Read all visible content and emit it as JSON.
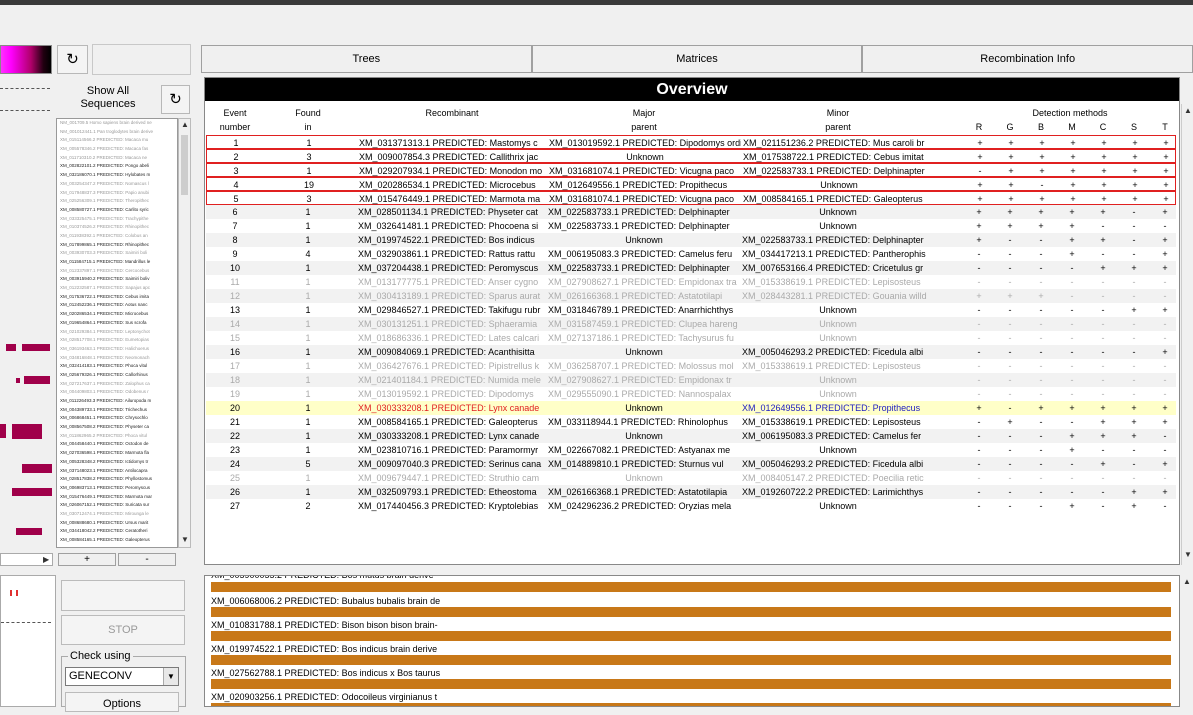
{
  "left": {
    "show_all_label": "Show All\nSequences",
    "plus_label": "+",
    "minus_label": "-",
    "sequences": [
      {
        "text": "NM_001709.5 Homo sapiens brain derived ne",
        "dim": true
      },
      {
        "text": "NM_001012441.1 Pan troglodytes brain derive",
        "dim": true
      },
      {
        "text": "XM_015114566.2 PREDICTED: Macaca mu",
        "dim": true
      },
      {
        "text": "XM_005578346.2 PREDICTED: Macaca fas",
        "dim": true
      },
      {
        "text": "XM_011710310.2 PREDICTED: Macaca ne",
        "dim": true
      },
      {
        "text": "XM_002822101.2 PREDICTED: Pongo abeli",
        "dim": false
      },
      {
        "text": "XM_032186070.1 PREDICTED: Hylobates m",
        "dim": false
      },
      {
        "text": "XM_003254347.2 PREDICTED: Nomascus l",
        "dim": true
      },
      {
        "text": "XM_017948837.3 PREDICTED: Papio anubi",
        "dim": true
      },
      {
        "text": "XM_025256309.1 PREDICTED: Theropithec",
        "dim": true
      },
      {
        "text": "XM_008580727.1 PREDICTED: Carlito syric",
        "dim": false
      },
      {
        "text": "XM_033325475.1 PREDICTED: Trachypithe",
        "dim": true
      },
      {
        "text": "XM_010374526.2 PREDICTED: Rhinopithec",
        "dim": true
      },
      {
        "text": "XM_011938392.1 PREDICTED: Colobus an",
        "dim": true
      },
      {
        "text": "XM_017899865.1 PREDICTED: Rhinopithec",
        "dim": false
      },
      {
        "text": "XM_003930703.3 PREDICTED: Saimiri boli",
        "dim": true
      },
      {
        "text": "XM_011584715.1 PREDICTED: Mandrillus le",
        "dim": false
      },
      {
        "text": "XM_012337897.1 PREDICTED: Cercocebus",
        "dim": true
      },
      {
        "text": "XM_003915940.2 PREDICTED: Saimiri boliv",
        "dim": false
      },
      {
        "text": "XM_012232587.1 PREDICTED: Sapajus apc",
        "dim": true
      },
      {
        "text": "XM_017536722.1 PREDICTED: Cebus imita",
        "dim": false
      },
      {
        "text": "XM_012452236.1 PREDICTED: Aotus nanc",
        "dim": false
      },
      {
        "text": "XM_020286534.1 PREDICTED: Microcebus",
        "dim": false
      },
      {
        "text": "XM_019654864.1 PREDICTED: Sus scrofa",
        "dim": false
      },
      {
        "text": "XM_021029384.1 PREDICTED: Leptonychot",
        "dim": true
      },
      {
        "text": "XM_028517708.1 PREDICTED: Eumetopias",
        "dim": true
      },
      {
        "text": "XM_036193463.1 PREDICTED: Halichoerus",
        "dim": true
      },
      {
        "text": "XM_034816848.1 PREDICTED: Neomonach",
        "dim": true
      },
      {
        "text": "XM_032414183.1 PREDICTED: Phoca vitul",
        "dim": false
      },
      {
        "text": "XM_025679326.1 PREDICTED: Callorhinus",
        "dim": false
      },
      {
        "text": "XM_027217637.1 PREDICTED: Zalophus ca",
        "dim": true
      },
      {
        "text": "XM_004409803.1 PREDICTED: Odobenus r",
        "dim": true
      },
      {
        "text": "XM_011226493.3 PREDICTED: Ailuropoda m",
        "dim": false
      },
      {
        "text": "XM_004389733.1 PREDICTED: Trichechus",
        "dim": false
      },
      {
        "text": "XM_006868451.1 PREDICTED: Chrysochlo",
        "dim": false
      },
      {
        "text": "XM_008567508.2 PREDICTED: Physeter ca",
        "dim": false
      },
      {
        "text": "XM_011862965.2 PREDICTED: Phoca vitul",
        "dim": true
      },
      {
        "text": "XM_004458440.1 PREDICTED: Octodon de",
        "dim": false
      },
      {
        "text": "XM_027036598.1 PREDICTED: Marmota fla",
        "dim": false
      },
      {
        "text": "XM_005328348.2 PREDICTED: Ictidomys tr",
        "dim": false
      },
      {
        "text": "XM_037148023.1 PREDICTED: Antilocapra",
        "dim": false
      },
      {
        "text": "XM_028517838.2 PREDICTED: Phyllostomus",
        "dim": false
      },
      {
        "text": "XM_006983713.1 PREDICTED: Peromyscus",
        "dim": false
      },
      {
        "text": "XM_015476449.1 PREDICTED: Marmota mar",
        "dim": false
      },
      {
        "text": "XM_026067152.1 PREDICTED: Suricata sur",
        "dim": false
      },
      {
        "text": "XM_030712474.1 PREDICTED: Mirounga le",
        "dim": true
      },
      {
        "text": "XM_008688680.1 PREDICTED: Ursus marit",
        "dim": false
      },
      {
        "text": "XM_034418042.2 PREDICTED: Ceratotheri",
        "dim": false
      },
      {
        "text": "XM_008584165.1 PREDICTED: Galeopterus",
        "dim": false
      },
      {
        "text": "XM_026872222.1 PREDICTED: Ursus arcto",
        "dim": true
      },
      {
        "text": "XM_007851052.1 PREDICTED: Orycteropus",
        "dim": false
      },
      {
        "text": "XM_028412273.1 PREDICTED: Urocitellus p",
        "dim": true
      },
      {
        "text": "XM_024598693.1 PREDICTED: Desmodus",
        "dim": false
      }
    ],
    "stop_label": "STOP",
    "check_using_label": "Check using",
    "method_value": "GENECONV",
    "options_label": "Options"
  },
  "tabs": [
    {
      "label": "Trees"
    },
    {
      "label": "Matrices"
    },
    {
      "label": "Recombination Info"
    }
  ],
  "overview": {
    "title": "Overview",
    "headers": {
      "event1": "Event",
      "event2": "number",
      "found1": "Found",
      "found2": "in",
      "recombinant": "Recombinant",
      "major1": "Major",
      "major2": "parent",
      "minor1": "Minor",
      "minor2": "parent",
      "detection": "Detection methods",
      "methods": [
        "R",
        "G",
        "B",
        "M",
        "C",
        "S",
        "T"
      ]
    },
    "rows": [
      {
        "ev": "1",
        "found": "1",
        "rec": "XM_031371313.1 PREDICTED: Mastomys c",
        "maj": "XM_013019592.1 PREDICTED: Dipodomys ordi",
        "min": "XM_021151236.2 PREDICTED: Mus caroli br",
        "det": [
          "+",
          "+",
          "+",
          "+",
          "+",
          "+",
          "+"
        ],
        "style": "boxed"
      },
      {
        "ev": "2",
        "found": "3",
        "rec": "XM_009007854.3 PREDICTED: Callithrix jac",
        "maj": "Unknown",
        "min": "XM_017538722.1 PREDICTED: Cebus imitat",
        "det": [
          "+",
          "+",
          "+",
          "+",
          "+",
          "+",
          "+"
        ],
        "style": "boxed"
      },
      {
        "ev": "3",
        "found": "1",
        "rec": "XM_029207934.1 PREDICTED: Monodon mo",
        "maj": "XM_031681074.1 PREDICTED: Vicugna paco",
        "min": "XM_022583733.1 PREDICTED: Delphinapter",
        "det": [
          "-",
          "+",
          "+",
          "+",
          "+",
          "+",
          "+"
        ],
        "style": "boxed"
      },
      {
        "ev": "4",
        "found": "19",
        "rec": "XM_020286534.1 PREDICTED: Microcebus",
        "maj": "XM_012649556.1 PREDICTED: Propithecus",
        "min": "Unknown",
        "det": [
          "+",
          "+",
          "-",
          "+",
          "+",
          "+",
          "+"
        ],
        "style": "boxed"
      },
      {
        "ev": "5",
        "found": "3",
        "rec": "XM_015476449.1 PREDICTED: Marmota ma",
        "maj": "XM_031681074.1 PREDICTED: Vicugna paco",
        "min": "XM_008584165.1 PREDICTED: Galeopterus",
        "det": [
          "+",
          "+",
          "+",
          "+",
          "+",
          "+",
          "+"
        ],
        "style": "boxed"
      },
      {
        "ev": "6",
        "found": "1",
        "rec": "XM_028501134.1 PREDICTED: Physeter cat",
        "maj": "XM_022583733.1 PREDICTED: Delphinapter",
        "min": "Unknown",
        "det": [
          "+",
          "+",
          "+",
          "+",
          "+",
          "-",
          "+"
        ],
        "style": ""
      },
      {
        "ev": "7",
        "found": "1",
        "rec": "XM_032641481.1 PREDICTED: Phocoena si",
        "maj": "XM_022583733.1 PREDICTED: Delphinapter",
        "min": "Unknown",
        "det": [
          "+",
          "+",
          "+",
          "+",
          "-",
          "-",
          "-"
        ],
        "style": ""
      },
      {
        "ev": "8",
        "found": "1",
        "rec": "XM_019974522.1 PREDICTED: Bos indicus",
        "maj": "Unknown",
        "min": "XM_022583733.1 PREDICTED: Delphinapter",
        "det": [
          "+",
          "-",
          "-",
          "+",
          "+",
          "-",
          "+"
        ],
        "style": ""
      },
      {
        "ev": "9",
        "found": "4",
        "rec": "XM_032903861.1 PREDICTED: Rattus rattu",
        "maj": "XM_006195083.3 PREDICTED: Camelus feru",
        "min": "XM_034417213.1 PREDICTED: Pantherophis",
        "det": [
          "-",
          "-",
          "-",
          "+",
          "-",
          "-",
          "+"
        ],
        "style": ""
      },
      {
        "ev": "10",
        "found": "1",
        "rec": "XM_037204438.1 PREDICTED: Peromyscus",
        "maj": "XM_022583733.1 PREDICTED: Delphinapter",
        "min": "XM_007653166.4 PREDICTED: Cricetulus gr",
        "det": [
          "-",
          "-",
          "-",
          "-",
          "+",
          "+",
          "+"
        ],
        "style": ""
      },
      {
        "ev": "11",
        "found": "1",
        "rec": "XM_013177775.1 PREDICTED: Anser cygno",
        "maj": "XM_027908627.1 PREDICTED: Empidonax tra",
        "min": "XM_015338619.1 PREDICTED: Lepisosteus",
        "det": [
          "-",
          "-",
          "-",
          "-",
          "-",
          "-",
          "-"
        ],
        "style": "grey"
      },
      {
        "ev": "12",
        "found": "1",
        "rec": "XM_030413189.1 PREDICTED: Sparus aurat",
        "maj": "XM_026166368.1 PREDICTED: Astatotilapi",
        "min": "XM_028443281.1 PREDICTED: Gouania willd",
        "det": [
          "+",
          "+",
          "+",
          "-",
          "-",
          "-",
          "-"
        ],
        "style": "grey"
      },
      {
        "ev": "13",
        "found": "1",
        "rec": "XM_029846527.1 PREDICTED: Takifugu rubr",
        "maj": "XM_031846789.1 PREDICTED: Anarrhichthys",
        "min": "Unknown",
        "det": [
          "-",
          "-",
          "-",
          "-",
          "-",
          "+",
          "+"
        ],
        "style": ""
      },
      {
        "ev": "14",
        "found": "1",
        "rec": "XM_030131251.1 PREDICTED: Sphaeramia",
        "maj": "XM_031587459.1 PREDICTED: Clupea hareng",
        "min": "Unknown",
        "det": [
          "-",
          "-",
          "-",
          "-",
          "-",
          "-",
          "-"
        ],
        "style": "grey"
      },
      {
        "ev": "15",
        "found": "1",
        "rec": "XM_018686336.1 PREDICTED: Lates calcari",
        "maj": "XM_027137186.1 PREDICTED: Tachysurus fu",
        "min": "Unknown",
        "det": [
          "-",
          "-",
          "-",
          "-",
          "-",
          "-",
          "-"
        ],
        "style": "grey"
      },
      {
        "ev": "16",
        "found": "1",
        "rec": "XM_009084069.1 PREDICTED: Acanthisitta",
        "maj": "Unknown",
        "min": "XM_005046293.2 PREDICTED: Ficedula albi",
        "det": [
          "-",
          "-",
          "-",
          "-",
          "-",
          "-",
          "+"
        ],
        "style": ""
      },
      {
        "ev": "17",
        "found": "1",
        "rec": "XM_036427676.1 PREDICTED: Pipistrellus k",
        "maj": "XM_036258707.1 PREDICTED: Molossus mol",
        "min": "XM_015338619.1 PREDICTED: Lepisosteus",
        "det": [
          "-",
          "-",
          "-",
          "-",
          "-",
          "-",
          "-"
        ],
        "style": "grey"
      },
      {
        "ev": "18",
        "found": "1",
        "rec": "XM_021401184.1 PREDICTED: Numida mele",
        "maj": "XM_027908627.1 PREDICTED: Empidonax tr",
        "min": "Unknown",
        "det": [
          "-",
          "-",
          "-",
          "-",
          "-",
          "-",
          "-"
        ],
        "style": "grey"
      },
      {
        "ev": "19",
        "found": "1",
        "rec": "XM_013019592.1 PREDICTED: Dipodomys",
        "maj": "XM_029555090.1 PREDICTED: Nannospalax",
        "min": "Unknown",
        "det": [
          "-",
          "-",
          "-",
          "-",
          "-",
          "-",
          "-"
        ],
        "style": "grey"
      },
      {
        "ev": "20",
        "found": "1",
        "rec": "XM_030333208.1 PREDICTED: Lynx canade",
        "maj": "Unknown",
        "min": "XM_012649556.1 PREDICTED: Propithecus",
        "det": [
          "+",
          "-",
          "+",
          "+",
          "+",
          "+",
          "+"
        ],
        "style": "highlight"
      },
      {
        "ev": "21",
        "found": "1",
        "rec": "XM_008584165.1 PREDICTED: Galeopterus",
        "maj": "XM_033118944.1 PREDICTED: Rhinolophus",
        "min": "XM_015338619.1 PREDICTED: Lepisosteus",
        "det": [
          "-",
          "+",
          "-",
          "-",
          "+",
          "+",
          "+"
        ],
        "style": ""
      },
      {
        "ev": "22",
        "found": "1",
        "rec": "XM_030333208.1 PREDICTED: Lynx canade",
        "maj": "Unknown",
        "min": "XM_006195083.3 PREDICTED: Camelus fer",
        "det": [
          "-",
          "-",
          "-",
          "+",
          "+",
          "+",
          "-"
        ],
        "style": ""
      },
      {
        "ev": "23",
        "found": "1",
        "rec": "XM_023810716.1 PREDICTED: Paramormyr",
        "maj": "XM_022667082.1 PREDICTED: Astyanax me",
        "min": "Unknown",
        "det": [
          "-",
          "-",
          "-",
          "+",
          "-",
          "-",
          "-"
        ],
        "style": ""
      },
      {
        "ev": "24",
        "found": "5",
        "rec": "XM_009097040.3 PREDICTED: Serinus cana",
        "maj": "XM_014889810.1 PREDICTED: Sturnus vul",
        "min": "XM_005046293.2 PREDICTED: Ficedula albi",
        "det": [
          "-",
          "-",
          "-",
          "-",
          "+",
          "-",
          "+"
        ],
        "style": ""
      },
      {
        "ev": "25",
        "found": "1",
        "rec": "XM_009679447.1 PREDICTED: Struthio cam",
        "maj": "Unknown",
        "min": "XM_008405147.2 PREDICTED: Poecilia retic",
        "det": [
          "-",
          "-",
          "-",
          "-",
          "-",
          "-",
          "-"
        ],
        "style": "grey"
      },
      {
        "ev": "26",
        "found": "1",
        "rec": "XM_032509793.1 PREDICTED: Etheostoma",
        "maj": "XM_026166368.1 PREDICTED: Astatotilapia",
        "min": "XM_019260722.2 PREDICTED: Larimichthys",
        "det": [
          "-",
          "-",
          "-",
          "-",
          "-",
          "+",
          "+"
        ],
        "style": ""
      },
      {
        "ev": "27",
        "found": "2",
        "rec": "XM_017440456.3 PREDICTED: Kryptolebias",
        "maj": "XM_024296236.2 PREDICTED: Oryzias mela",
        "min": "Unknown",
        "det": [
          "-",
          "-",
          "-",
          "+",
          "-",
          "+",
          "-"
        ],
        "style": ""
      }
    ]
  },
  "lower": {
    "items": [
      "XM_006068006.2 PREDICTED: Bubalus bubalis brain de",
      "XM_010831788.1 PREDICTED: Bison bison bison brain-",
      "XM_019974522.1 PREDICTED: Bos indicus brain derive",
      "XM_027562788.1 PREDICTED: Bos indicus x Bos taurus",
      "XM_020903256.1 PREDICTED: Odocoileus virginianus t"
    ],
    "top_partial": "XM_005900055.2 PREDICTED: Bos mutus brain derive",
    "bar_color": "#c87818"
  }
}
